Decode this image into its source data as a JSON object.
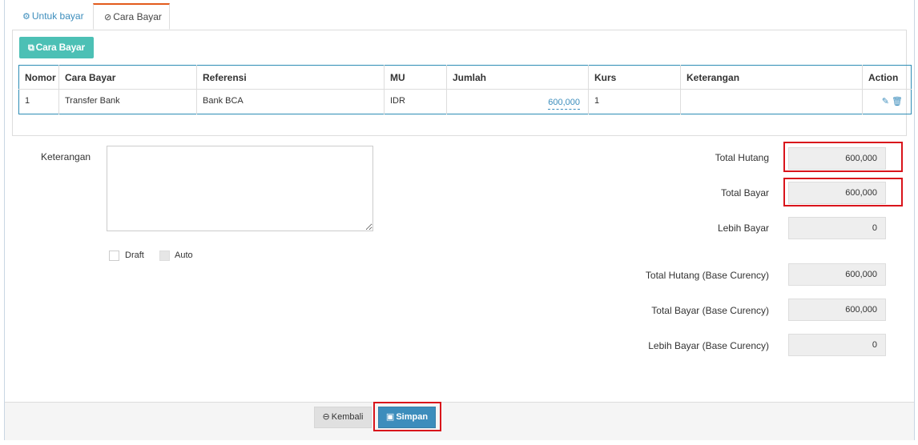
{
  "tabs": [
    {
      "label": "Untuk bayar",
      "icon": "cogs-icon"
    },
    {
      "label": "Cara Bayar",
      "icon": "check-circle-icon"
    }
  ],
  "add_button": {
    "label": "Cara Bayar",
    "icon": "copy-plus-icon"
  },
  "table": {
    "headers": [
      "Nomor",
      "Cara Bayar",
      "Referensi",
      "MU",
      "Jumlah",
      "Kurs",
      "Keterangan",
      "Action"
    ],
    "rows": [
      {
        "nomor": "1",
        "cara_bayar": "Transfer Bank",
        "referensi": "Bank BCA",
        "mu": "IDR",
        "jumlah": "600,000",
        "kurs": "1",
        "keterangan": ""
      }
    ]
  },
  "form": {
    "keterangan_label": "Keterangan",
    "keterangan_value": "",
    "draft_label": "Draft",
    "auto_label": "Auto"
  },
  "summary": [
    {
      "label": "Total Hutang",
      "value": "600,000",
      "highlighted": true
    },
    {
      "label": "Total Bayar",
      "value": "600,000",
      "highlighted": true
    },
    {
      "label": "Lebih Bayar",
      "value": "0",
      "highlighted": false
    },
    {
      "label": "Total Hutang (Base Curency)",
      "value": "600,000",
      "highlighted": false
    },
    {
      "label": "Total Bayar (Base Curency)",
      "value": "600,000",
      "highlighted": false
    },
    {
      "label": "Lebih Bayar (Base Curency)",
      "value": "0",
      "highlighted": false
    }
  ],
  "footer": {
    "back_label": "Kembali",
    "save_label": "Simpan"
  },
  "colors": {
    "accent": "#3c8dbc",
    "teal_button": "#4cc0b5",
    "highlight": "#d9141b",
    "active_tab": "#e25b1c"
  }
}
